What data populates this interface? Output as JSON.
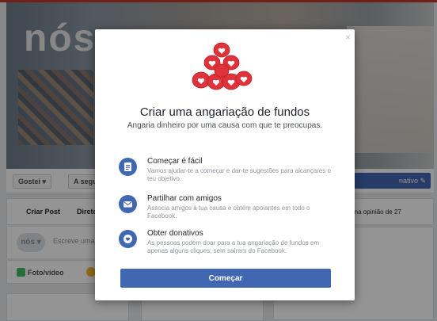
{
  "background": {
    "cover_logo": "nós",
    "like_label": "Gostei ▾",
    "follow_label": "A segu",
    "donate_label": "nativo ✎",
    "post_tabs": [
      "Criar Post",
      "Direto"
    ],
    "composer_avatar": "nós ▾",
    "composer_placeholder": "Escreve uma",
    "media_label": "Foto/vídeo",
    "rating_text": "e na opinião de 27"
  },
  "dialog": {
    "close_label": "×",
    "title": "Criar uma angariação de fundos",
    "subtitle": "Angaria dinheiro por uma causa com que te preocupas.",
    "features": [
      {
        "title": "Começar é fácil",
        "desc": "Vamos ajudar-te a começar e dar-te sugestões para alcançares o teu objetivo."
      },
      {
        "title": "Partilhar com amigos",
        "desc": "Associa amigos à tua causa e obtém apoiantes em todo o Facebook."
      },
      {
        "title": "Obter donativos",
        "desc": "As pessoas podem doar para a tua angariação de fundos em apenas alguns cliques, sem saírem do Facebook."
      }
    ],
    "cta_label": "Começar"
  },
  "colors": {
    "accent": "#4267b2",
    "illustration_red": "#e0323b"
  },
  "icons": [
    "document-icon",
    "envelope-icon",
    "heart-badge-icon",
    "close-icon",
    "fundraiser-hearts-illustration"
  ]
}
